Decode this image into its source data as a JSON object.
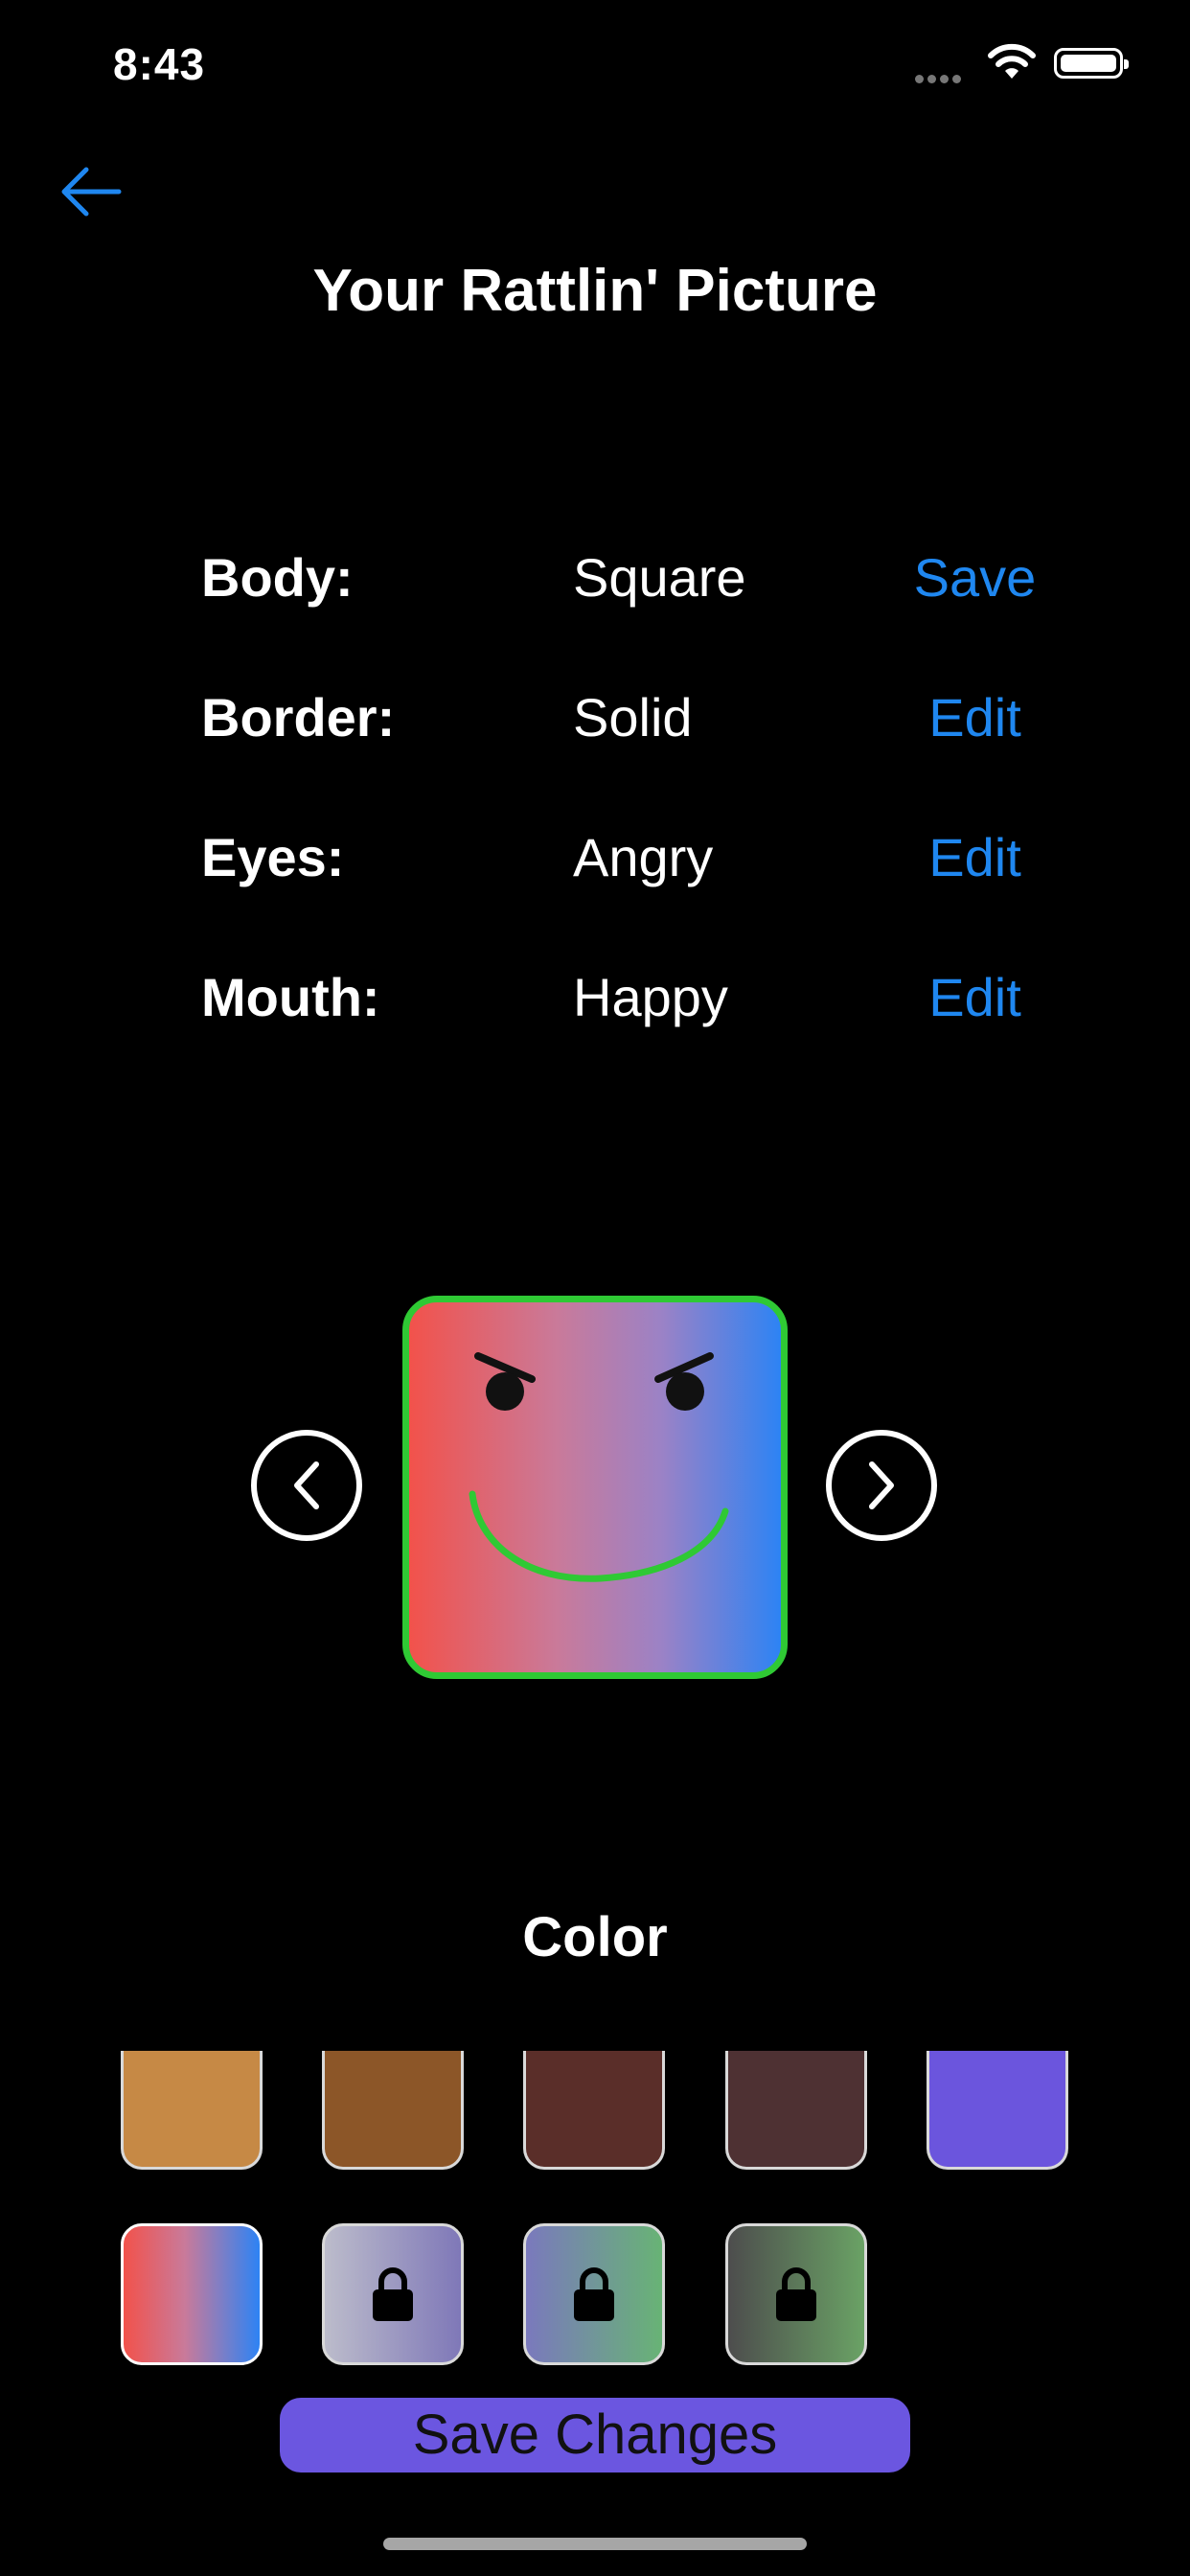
{
  "status_bar": {
    "time": "8:43"
  },
  "header": {
    "title": "Your Rattlin' Picture"
  },
  "attributes": [
    {
      "label": "Body:",
      "value": "Square",
      "action": "Save"
    },
    {
      "label": "Border:",
      "value": "Solid",
      "action": "Edit"
    },
    {
      "label": "Eyes:",
      "value": "Angry",
      "action": "Edit"
    },
    {
      "label": "Mouth:",
      "value": "Happy",
      "action": "Edit"
    }
  ],
  "color_section": {
    "heading": "Color",
    "swatches_row1": [
      {
        "color": "#c68945"
      },
      {
        "color": "#8c5628"
      },
      {
        "color": "#5a2e29"
      },
      {
        "color": "#4e3133"
      },
      {
        "color": "#6b55dd"
      }
    ],
    "swatches_row2": [
      {
        "gradient": [
          "#f2524b",
          "#2d83f4"
        ],
        "locked": false,
        "selected": true
      },
      {
        "gradient": [
          "#b9b9c8",
          "#7f78b8"
        ],
        "locked": true,
        "icon": "lock-icon"
      },
      {
        "gradient": [
          "#7a79bd",
          "#68b375"
        ],
        "locked": true,
        "icon": "lock-icon"
      },
      {
        "gradient": [
          "#4d4d4d",
          "#6aa265"
        ],
        "locked": true,
        "icon": "lock-icon"
      }
    ]
  },
  "footer": {
    "save_label": "Save Changes"
  },
  "colors": {
    "accent": "#1f87f0",
    "avatar_border": "#2fc934",
    "button": "#6b56e0"
  }
}
